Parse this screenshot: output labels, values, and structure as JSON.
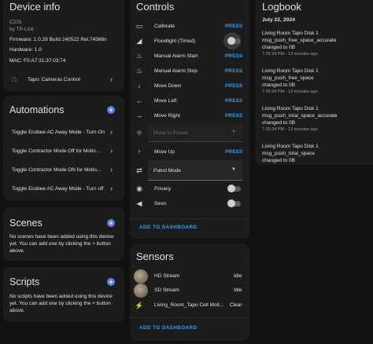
{
  "device_info": {
    "title": "Device info",
    "model": "C225",
    "manufacturer": "by TP-Link",
    "firmware": "Firmware: 1.0.29 Build 240522 Rel.74568n",
    "hardware": "Hardware: 1.0",
    "mac": "MAC: F0:A7:31:37:03:74",
    "integration_label": "Tapo: Cameras Control"
  },
  "automations": {
    "title": "Automations",
    "items": [
      "Toggle Ecobee AC Away Mode - Turn On",
      "Toggle Contractor Mode Off for Motio...",
      "Toggle Contractor Mode ON for Motio...",
      "Toggle Ecobee AC Away Mode - Turn off"
    ]
  },
  "scenes": {
    "title": "Scenes",
    "empty_text": "No scenes have been added using this device yet. You can add one by clicking the + button above."
  },
  "scripts": {
    "title": "Scripts",
    "empty_text": "No scripts have been added using this device yet. You can add one by clicking the + button above."
  },
  "controls": {
    "title": "Controls",
    "rows": [
      {
        "label": "Calibrate",
        "action": "PRESS",
        "icon": "calibrate-icon"
      },
      {
        "label": "Floodlight (Timed)",
        "action": "toggle",
        "icon": "floodlight-icon"
      },
      {
        "label": "Manual Alarm Start",
        "action": "PRESS",
        "icon": "alarm-icon"
      },
      {
        "label": "Manual Alarm Stop",
        "action": "PRESS",
        "icon": "alarm-off-icon"
      },
      {
        "label": "Move Down",
        "action": "PRESS",
        "icon": "arrow-down-icon"
      },
      {
        "label": "Move Left",
        "action": "PRESS",
        "icon": "arrow-left-icon"
      },
      {
        "label": "Move Right",
        "action": "PRESS",
        "icon": "arrow-right-icon"
      },
      {
        "label": "Move to Preset",
        "action": "select",
        "icon": "move-icon"
      },
      {
        "label": "Move Up",
        "action": "PRESS",
        "icon": "arrow-up-icon"
      },
      {
        "label": "Patrol Mode",
        "action": "select",
        "icon": "patrol-icon"
      },
      {
        "label": "Privacy",
        "action": "toggle",
        "icon": "eye-icon"
      },
      {
        "label": "Siren",
        "action": "toggle",
        "icon": "siren-icon"
      }
    ],
    "add_dashboard": "ADD TO DASHBOARD"
  },
  "sensors": {
    "title": "Sensors",
    "rows": [
      {
        "label": "HD Stream",
        "value": "Idle"
      },
      {
        "label": "SD Stream",
        "value": "Idle"
      },
      {
        "label": "Living_Room_Tapo Cell Moti...",
        "value": "Clear"
      }
    ],
    "add_dashboard": "ADD TO DASHBOARD"
  },
  "logbook": {
    "title": "Logbook",
    "date": "July 22, 2024",
    "entries": [
      {
        "line1": "Living Room Tapo Disk 1",
        "line2": "msg_push_free_space_accurate",
        "line3": "changed to 0B",
        "time": "7:26:34 PM - 13 minutes ago"
      },
      {
        "line1": "Living Room Tapo Disk 1",
        "line2": "msg_push_free_space",
        "line3": "changed to 0B",
        "time": "7:26:34 PM - 13 minutes ago"
      },
      {
        "line1": "Living Room Tapo Disk 1",
        "line2": "msg_push_total_space_accurate",
        "line3": "changed to 0B",
        "time": "7:26:34 PM - 13 minutes ago"
      },
      {
        "line1": "Living Room Tapo Disk 1",
        "line2": "msg_push_total_space",
        "line3": "changed to 0B",
        "time": ""
      }
    ]
  }
}
